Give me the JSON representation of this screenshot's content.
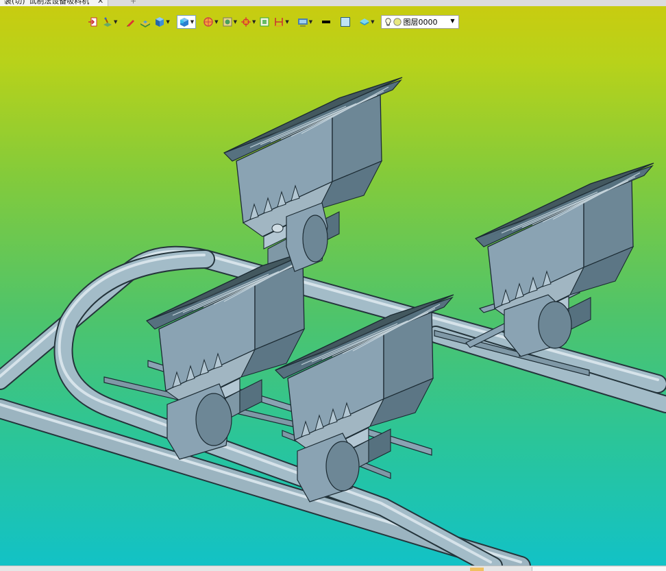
{
  "tab": {
    "title": "装(切)“试制法设备吸料机”",
    "close": "✕",
    "plus": "+"
  },
  "toolbar": {
    "tools": [
      {
        "icon": "exit-sketch-icon",
        "dropdown": false
      },
      {
        "icon": "sketch-plane-icon",
        "dropdown": true
      },
      {
        "icon": "pencil-icon",
        "dropdown": false
      },
      {
        "icon": "extrude-icon",
        "dropdown": false
      },
      {
        "icon": "solid-cube-icon",
        "dropdown": true
      },
      {
        "icon": "render-mode-icon",
        "dropdown": true,
        "active": true
      },
      {
        "icon": "view-orient-icon",
        "dropdown": true
      },
      {
        "icon": "zoom-fit-icon",
        "dropdown": true
      },
      {
        "icon": "move-target-icon",
        "dropdown": true
      },
      {
        "icon": "measure-icon",
        "dropdown": false
      },
      {
        "icon": "dimension-icon",
        "dropdown": true
      },
      {
        "icon": "display-settings-icon",
        "dropdown": true
      },
      {
        "icon": "line-color-icon",
        "dropdown": false
      },
      {
        "icon": "fill-color-icon",
        "dropdown": false
      },
      {
        "icon": "layer-stack-icon",
        "dropdown": true
      }
    ],
    "layer": {
      "label": "图层0000",
      "bulb": "light-bulb-icon",
      "status": "layer-status-icon"
    }
  },
  "colors": {
    "steel": "#8aa3b3",
    "steel_dark": "#56717f",
    "steel_light": "#b3c7d3",
    "outline": "#1b2a32",
    "pipe": "#a3bcc8"
  }
}
